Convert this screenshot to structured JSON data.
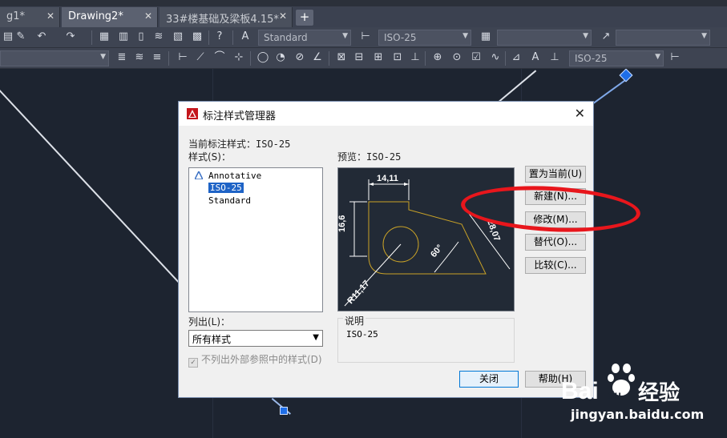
{
  "tabs": [
    {
      "label": "g1*"
    },
    {
      "label": "Drawing2*"
    },
    {
      "label": "33#楼基础及梁板4.15*"
    }
  ],
  "toolbar1": {
    "text_style": "Standard",
    "dim_style": "ISO-25",
    "table_style": "",
    "multileader_style": ""
  },
  "toolbar2": {
    "layer_combo": "",
    "dim_style": "ISO-25"
  },
  "dialog": {
    "title": "标注样式管理器",
    "current_style_label": "当前标注样式：ISO-25",
    "styles_label": "样式(S)：",
    "styles": [
      "Annotative",
      "ISO-25",
      "Standard"
    ],
    "selected_style": "ISO-25",
    "preview_label": "预览：ISO-25",
    "list_label": "列出(L)：",
    "list_value": "所有样式",
    "exclude_xref_label": "不列出外部参照中的样式(D)",
    "desc_caption": "说明",
    "desc_value": "ISO-25",
    "buttons": {
      "set_current": "置为当前(U)",
      "new": "新建(N)...",
      "modify": "修改(M)...",
      "override": "替代(O)...",
      "compare": "比较(C)...",
      "close": "关闭",
      "help": "帮助(H)"
    },
    "preview_dims": {
      "top": "14,11",
      "left": "16,6",
      "right": "28,07",
      "angle": "60°",
      "radius": "R11,17"
    }
  },
  "watermark": {
    "brand": "Bai",
    "brand2": "du",
    "cn": "经验",
    "url": "jingyan.baidu.com"
  },
  "colors": {
    "canvas": "#1d2430",
    "highlight_oval": "#e8161c",
    "selection": "#1e63c6",
    "grip": "#1e6ee8"
  }
}
